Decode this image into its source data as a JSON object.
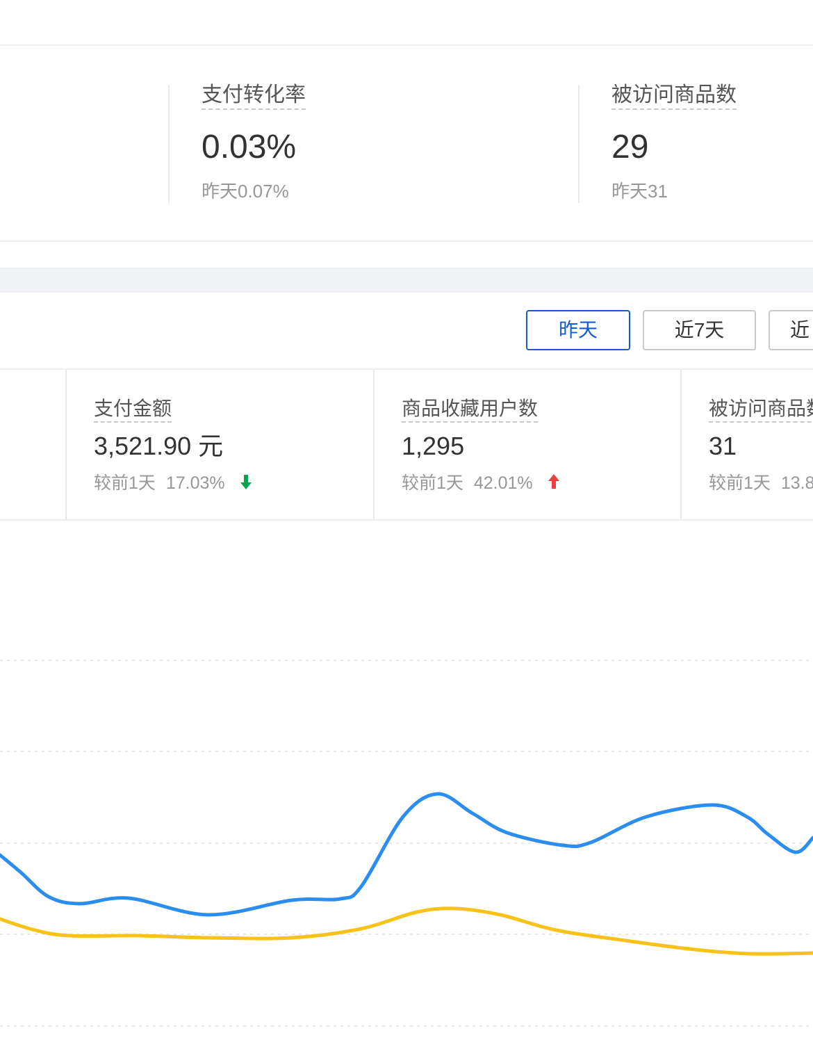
{
  "realtime": {
    "conversion": {
      "label": "支付转化率",
      "value": "0.03%",
      "yesterday": "昨天0.07%"
    },
    "visited_goods": {
      "label": "被访问商品数",
      "value": "29",
      "yesterday": "昨天31"
    }
  },
  "period_buttons": [
    {
      "label": "昨天",
      "active": true
    },
    {
      "label": "近7天",
      "active": false
    },
    {
      "label": "近",
      "active": false
    }
  ],
  "metrics": [
    {
      "label": "支付金额",
      "value": "3,521.90 元",
      "compare_prefix": "较前1天",
      "compare_value": "17.03%",
      "trend": "down",
      "trend_color": "#07a34f"
    },
    {
      "label": "商品收藏用户数",
      "value": "1,295",
      "compare_prefix": "较前1天",
      "compare_value": "42.01%",
      "trend": "up",
      "trend_color": "#ee3f3f"
    },
    {
      "label": "被访问商品数",
      "value": "31",
      "compare_prefix": "较前1天",
      "compare_value": "13.8",
      "trend": "",
      "trend_color": ""
    }
  ],
  "chart_data": {
    "type": "line",
    "grid": true,
    "series": [
      {
        "color": "#2b8def",
        "points": [
          [
            0,
            1230
          ],
          [
            30,
            1255
          ],
          [
            70,
            1290
          ],
          [
            115,
            1300
          ],
          [
            185,
            1292
          ],
          [
            300,
            1316
          ],
          [
            420,
            1295
          ],
          [
            490,
            1293
          ],
          [
            520,
            1275
          ],
          [
            580,
            1175
          ],
          [
            630,
            1142
          ],
          [
            680,
            1170
          ],
          [
            730,
            1198
          ],
          [
            810,
            1216
          ],
          [
            850,
            1212
          ],
          [
            930,
            1175
          ],
          [
            1025,
            1158
          ],
          [
            1075,
            1175
          ],
          [
            1105,
            1200
          ],
          [
            1145,
            1226
          ],
          [
            1170,
            1205
          ]
        ]
      },
      {
        "color": "#f8c219",
        "points": [
          [
            0,
            1322
          ],
          [
            50,
            1338
          ],
          [
            100,
            1346
          ],
          [
            200,
            1346
          ],
          [
            300,
            1349
          ],
          [
            420,
            1349
          ],
          [
            520,
            1336
          ],
          [
            600,
            1312
          ],
          [
            655,
            1307
          ],
          [
            720,
            1316
          ],
          [
            800,
            1338
          ],
          [
            900,
            1353
          ],
          [
            1000,
            1366
          ],
          [
            1080,
            1372
          ],
          [
            1170,
            1371
          ]
        ]
      }
    ]
  }
}
